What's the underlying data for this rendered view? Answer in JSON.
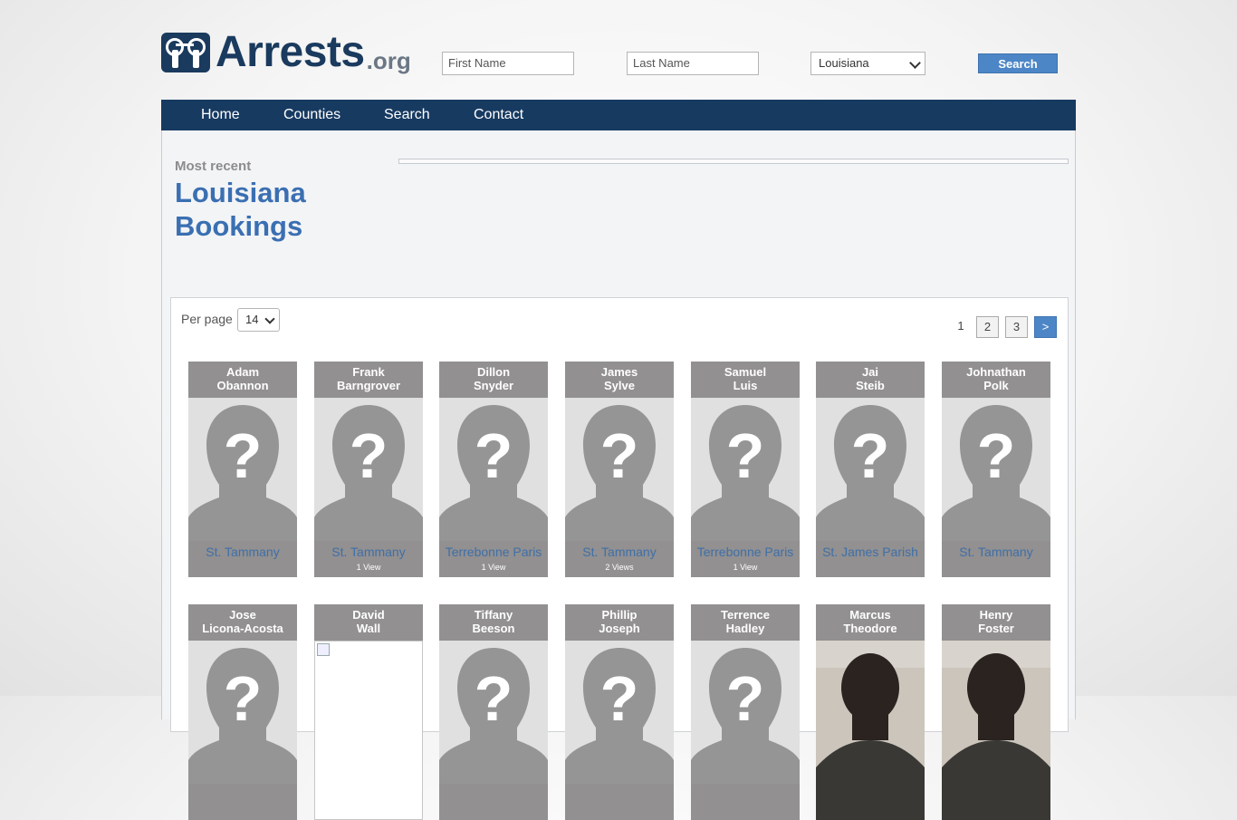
{
  "header": {
    "logo_main": "Arrests",
    "logo_tld": ".org",
    "first_name_placeholder": "First Name",
    "last_name_placeholder": "Last Name",
    "state_selected": "Louisiana",
    "search_label": "Search"
  },
  "nav": {
    "items": [
      {
        "label": "Home"
      },
      {
        "label": "Counties"
      },
      {
        "label": "Search"
      },
      {
        "label": "Contact"
      }
    ]
  },
  "main": {
    "most_recent": "Most recent",
    "title_line1": "Louisiana",
    "title_line2": "Bookings",
    "per_page_label": "Per page",
    "per_page_value": "14",
    "pagination": {
      "current": "1",
      "pages": [
        "2",
        "3"
      ],
      "next": ">"
    }
  },
  "bookings": [
    {
      "first": "Adam",
      "last": "Obannon",
      "county": "St. Tammany",
      "views": "",
      "photo": "silhouette"
    },
    {
      "first": "Frank",
      "last": "Barngrover",
      "county": "St. Tammany",
      "views": "1 View",
      "photo": "silhouette"
    },
    {
      "first": "Dillon",
      "last": "Snyder",
      "county": "Terrebonne Paris",
      "views": "1 View",
      "photo": "silhouette"
    },
    {
      "first": "James",
      "last": "Sylve",
      "county": "St. Tammany",
      "views": "2 Views",
      "photo": "silhouette"
    },
    {
      "first": "Samuel",
      "last": "Luis",
      "county": "Terrebonne Paris",
      "views": "1 View",
      "photo": "silhouette"
    },
    {
      "first": "Jai",
      "last": "Steib",
      "county": "St. James Parish",
      "views": "",
      "photo": "silhouette"
    },
    {
      "first": "Johnathan",
      "last": "Polk",
      "county": "St. Tammany",
      "views": "",
      "photo": "silhouette"
    },
    {
      "first": "Jose",
      "last": "Licona-Acosta",
      "county": "",
      "views": "",
      "photo": "silhouette"
    },
    {
      "first": "David",
      "last": "Wall",
      "county": "",
      "views": "",
      "photo": "broken"
    },
    {
      "first": "Tiffany",
      "last": "Beeson",
      "county": "",
      "views": "",
      "photo": "silhouette"
    },
    {
      "first": "Phillip",
      "last": "Joseph",
      "county": "",
      "views": "",
      "photo": "silhouette"
    },
    {
      "first": "Terrence",
      "last": "Hadley",
      "county": "",
      "views": "",
      "photo": "silhouette"
    },
    {
      "first": "Marcus",
      "last": "Theodore",
      "county": "",
      "views": "",
      "photo": "face"
    },
    {
      "first": "Henry",
      "last": "Foster",
      "county": "",
      "views": "",
      "photo": "face"
    }
  ],
  "colors": {
    "navy": "#173a61",
    "accent": "#4c86c6",
    "link": "#3f6fa8",
    "card": "#929090"
  }
}
